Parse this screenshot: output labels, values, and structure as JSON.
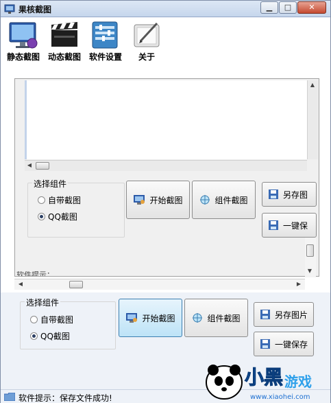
{
  "window": {
    "title": "果核截图",
    "controls": {
      "minimize": "▁",
      "maximize": "□",
      "close": "✕"
    }
  },
  "toolbar": {
    "items": [
      {
        "label": "静态截图",
        "icon": "monitor-icon"
      },
      {
        "label": "动态截图",
        "icon": "clapperboard-icon"
      },
      {
        "label": "软件设置",
        "icon": "settings-panel-icon"
      },
      {
        "label": "关于",
        "icon": "about-pen-icon"
      }
    ]
  },
  "nested": {
    "group": {
      "title": "选择组件",
      "options": [
        "自带截图",
        "QQ截图"
      ],
      "selected": "QQ截图"
    },
    "buttons": {
      "start": "开始截图",
      "component": "组件截图",
      "save_as": "另存图",
      "one_key": "一键保"
    },
    "partial_label": "软件提示："
  },
  "main": {
    "group": {
      "title": "选择组件",
      "options": [
        "自带截图",
        "QQ截图"
      ],
      "selected": "QQ截图"
    },
    "buttons": {
      "start": "开始截图",
      "component": "组件截图",
      "save_as": "另存图片",
      "one_key": "一键保存"
    }
  },
  "status": {
    "text": "软件提示：保存文件成功!"
  },
  "watermark": {
    "brand": "小黑游戏",
    "url": "www.xiaohei.com"
  },
  "colors": {
    "accent": "#3c7fb1",
    "active_button": "#bde3f7",
    "title_bar": "#c6d6ec"
  }
}
